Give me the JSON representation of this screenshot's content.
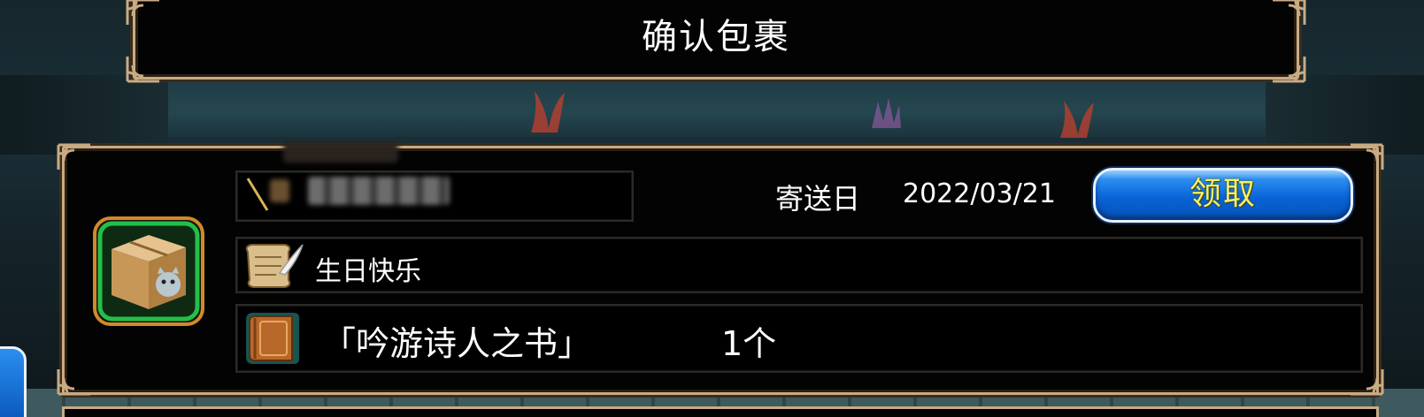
{
  "dialog": {
    "title": "确认包裹"
  },
  "parcel": {
    "sent_label": "寄送日",
    "sent_date": "2022/03/21",
    "claim_button_label": "领取",
    "message": "生日快乐",
    "item_name": "「吟游诗人之书」",
    "item_quantity": "1个"
  },
  "icons": {
    "parcel": "cardboard-box-icon",
    "message": "scroll-quill-icon",
    "item": "book-icon"
  },
  "colors": {
    "frame_gold": "#c9ab83",
    "claim_button_blue": "#0a63d8",
    "claim_text_yellow": "#f3f06a",
    "highlight_green": "#22c04a"
  }
}
